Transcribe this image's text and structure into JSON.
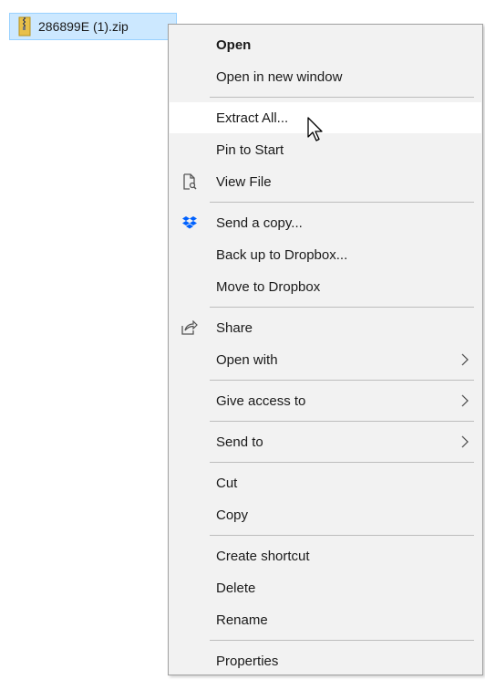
{
  "file": {
    "name": "286899E (1).zip",
    "icon": "zip-folder-icon"
  },
  "menu": {
    "open": "Open",
    "open_new_window": "Open in new window",
    "extract_all": "Extract All...",
    "pin_to_start": "Pin to Start",
    "view_file": "View File",
    "send_a_copy": "Send a copy...",
    "back_up_dropbox": "Back up to Dropbox...",
    "move_to_dropbox": "Move to Dropbox",
    "share": "Share",
    "open_with": "Open with",
    "give_access_to": "Give access to",
    "send_to": "Send to",
    "cut": "Cut",
    "copy": "Copy",
    "create_shortcut": "Create shortcut",
    "delete": "Delete",
    "rename": "Rename",
    "properties": "Properties"
  },
  "colors": {
    "selection_bg": "#cce8ff",
    "menu_bg": "#f2f2f2",
    "hover_bg": "#ffffff",
    "dropbox_blue": "#0061fe"
  }
}
